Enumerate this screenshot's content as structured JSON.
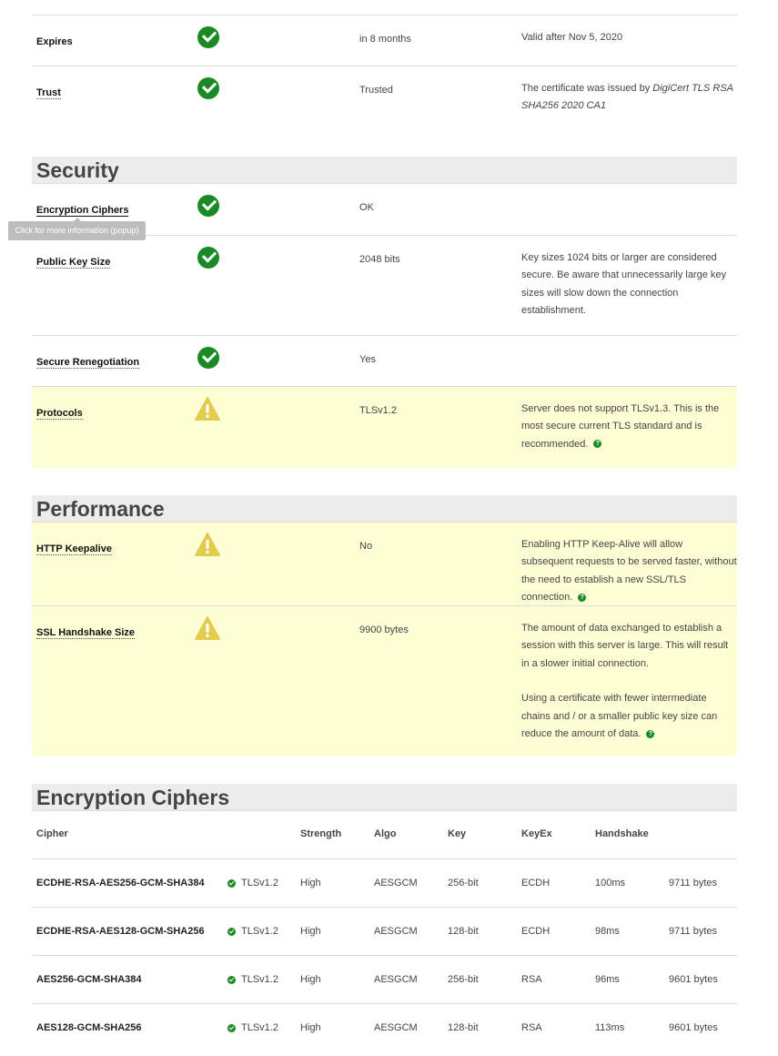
{
  "certificate": {
    "rows": [
      {
        "label": "Expires",
        "value": "in 8 months",
        "info": "Valid after Nov 5, 2020"
      },
      {
        "label": "Trust",
        "value": "Trusted",
        "info_prefix": "The certificate was issued by ",
        "info_em": "DigiCert TLS RSA SHA256 2020 CA1"
      }
    ]
  },
  "security": {
    "title": "Security",
    "tooltip": "Click for more information (popup)",
    "rows": [
      {
        "label": "Encryption Ciphers",
        "status": "ok",
        "value": "OK",
        "info": ""
      },
      {
        "label": "Public Key Size",
        "status": "ok",
        "value": "2048 bits",
        "info": "Key sizes 1024 bits or larger are considered secure. Be aware that unnecessarily large key sizes will slow down the connection establishment."
      },
      {
        "label": "Secure Renegotiation",
        "status": "ok",
        "value": "Yes",
        "info": ""
      },
      {
        "label": "Protocols",
        "status": "warning",
        "value": "TLSv1.2",
        "info": "Server does not support TLSv1.3. This is the most secure current TLS standard and is recommended."
      }
    ]
  },
  "performance": {
    "title": "Performance",
    "rows": [
      {
        "label": "HTTP Keepalive",
        "status": "warning",
        "value": "No",
        "info": "Enabling HTTP Keep-Alive will allow subsequent requests to be served faster, without the need to establish a new SSL/TLS connection."
      },
      {
        "label": "SSL Handshake Size",
        "status": "warning",
        "value": "9900 bytes",
        "info": "The amount of data exchanged to establish a session with this server is large. This will result in a slower initial connection.",
        "info2": "Using a certificate with fewer intermediate chains and / or a smaller public key size can reduce the amount of data."
      }
    ]
  },
  "ciphers": {
    "title": "Encryption Ciphers",
    "headers": {
      "cipher": "Cipher",
      "strength": "Strength",
      "algo": "Algo",
      "key": "Key",
      "keyex": "KeyEx",
      "handshake": "Handshake"
    },
    "rows": [
      {
        "cipher": "ECDHE-RSA-AES256-GCM-SHA384",
        "protocol": "TLSv1.2",
        "strength": "High",
        "algo": "AESGCM",
        "key": "256-bit",
        "keyex": "ECDH",
        "handshake": "100ms",
        "size": "9711 bytes"
      },
      {
        "cipher": "ECDHE-RSA-AES128-GCM-SHA256",
        "protocol": "TLSv1.2",
        "strength": "High",
        "algo": "AESGCM",
        "key": "128-bit",
        "keyex": "ECDH",
        "handshake": "98ms",
        "size": "9711 bytes"
      },
      {
        "cipher": "AES256-GCM-SHA384",
        "protocol": "TLSv1.2",
        "strength": "High",
        "algo": "AESGCM",
        "key": "256-bit",
        "keyex": "RSA",
        "handshake": "96ms",
        "size": "9601 bytes"
      },
      {
        "cipher": "AES128-GCM-SHA256",
        "protocol": "TLSv1.2",
        "strength": "High",
        "algo": "AESGCM",
        "key": "128-bit",
        "keyex": "RSA",
        "handshake": "113ms",
        "size": "9601 bytes"
      }
    ]
  },
  "icons": {
    "ok": "check-circle-icon",
    "warning": "warning-triangle-icon",
    "help": "question-circle-icon"
  },
  "colors": {
    "ok": "#1a8a24",
    "warning": "#e3cc4d",
    "warning_row_bg": "#fefed6"
  }
}
